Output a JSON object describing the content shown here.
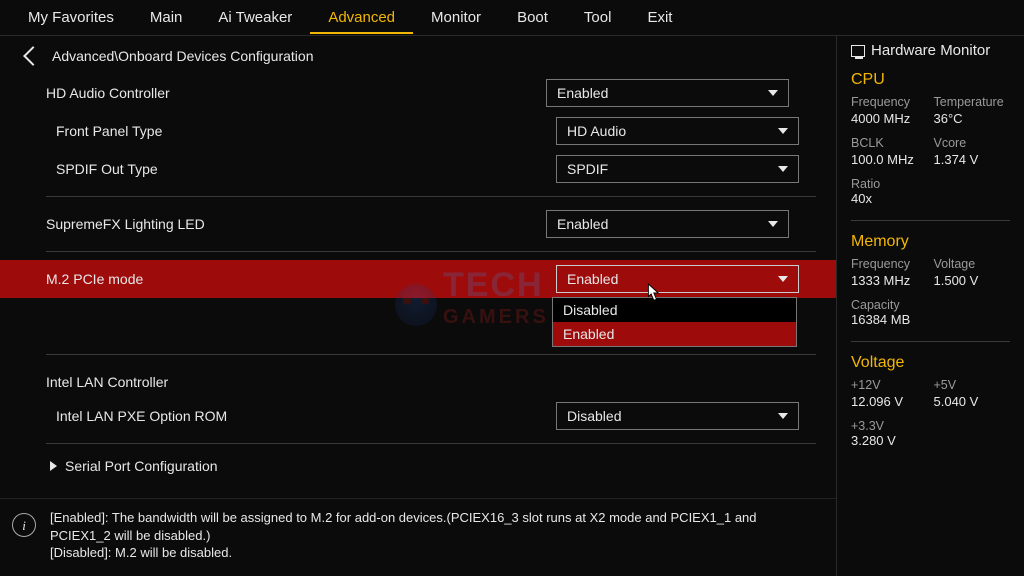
{
  "nav": {
    "tabs": [
      {
        "label": "My Favorites"
      },
      {
        "label": "Main"
      },
      {
        "label": "Ai Tweaker"
      },
      {
        "label": "Advanced",
        "active": true
      },
      {
        "label": "Monitor"
      },
      {
        "label": "Boot"
      },
      {
        "label": "Tool"
      },
      {
        "label": "Exit"
      }
    ]
  },
  "breadcrumb": "Advanced\\Onboard Devices Configuration",
  "settings": {
    "hd_audio": {
      "label": "HD Audio Controller",
      "value": "Enabled"
    },
    "front_panel": {
      "label": "Front Panel Type",
      "value": "HD Audio"
    },
    "spdif": {
      "label": "SPDIF Out Type",
      "value": "SPDIF"
    },
    "supremefx": {
      "label": "SupremeFX Lighting LED",
      "value": "Enabled"
    },
    "m2": {
      "label": "M.2 PCIe mode",
      "value": "Enabled",
      "options": [
        "Disabled",
        "Enabled"
      ],
      "selected_option": "Enabled"
    },
    "lan": {
      "label": "Intel LAN Controller",
      "value": ""
    },
    "pxe": {
      "label": "Intel LAN PXE Option ROM",
      "value": "Disabled"
    },
    "serial": {
      "label": "Serial Port Configuration"
    }
  },
  "help": {
    "line1": "[Enabled]: The bandwidth will be assigned to M.2 for add-on devices.(PCIEX16_3 slot runs at X2 mode and PCIEX1_1 and PCIEX1_2 will be disabled.)",
    "line2": "[Disabled]: M.2 will be disabled."
  },
  "hw": {
    "title": "Hardware Monitor",
    "cpu": {
      "title": "CPU",
      "freq_k": "Frequency",
      "freq_v": "4000 MHz",
      "temp_k": "Temperature",
      "temp_v": "36°C",
      "bclk_k": "BCLK",
      "bclk_v": "100.0 MHz",
      "vcore_k": "Vcore",
      "vcore_v": "1.374 V",
      "ratio_k": "Ratio",
      "ratio_v": "40x"
    },
    "mem": {
      "title": "Memory",
      "freq_k": "Frequency",
      "freq_v": "1333 MHz",
      "volt_k": "Voltage",
      "volt_v": "1.500 V",
      "cap_k": "Capacity",
      "cap_v": "16384 MB"
    },
    "volt": {
      "title": "Voltage",
      "p12_k": "+12V",
      "p12_v": "12.096 V",
      "p5_k": "+5V",
      "p5_v": "5.040 V",
      "p33_k": "+3.3V",
      "p33_v": "3.280 V"
    }
  },
  "watermark": {
    "t1": "TECH",
    "t2": "GAMERS"
  }
}
